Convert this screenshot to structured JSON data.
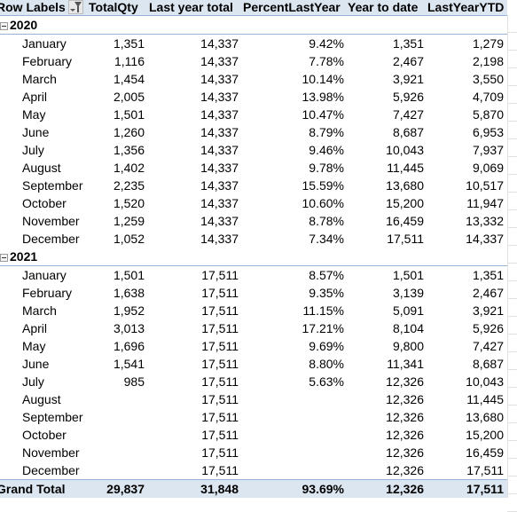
{
  "pivot": {
    "headers": {
      "row_labels": "Row Labels",
      "total_qty": "TotalQty",
      "last_year_total": "Last year total",
      "percent_last_year": "PercentLastYear",
      "year_to_date": "Year to date",
      "last_year_ytd": "LastYearYTD"
    },
    "filter_icon": "filter-dropdown-icon",
    "years": [
      {
        "label": "2020",
        "months": [
          {
            "month": "January",
            "total_qty": "1,351",
            "last_year_total": "14,337",
            "percent_last_year": "9.42%",
            "year_to_date": "1,351",
            "last_year_ytd": "1,279"
          },
          {
            "month": "February",
            "total_qty": "1,116",
            "last_year_total": "14,337",
            "percent_last_year": "7.78%",
            "year_to_date": "2,467",
            "last_year_ytd": "2,198"
          },
          {
            "month": "March",
            "total_qty": "1,454",
            "last_year_total": "14,337",
            "percent_last_year": "10.14%",
            "year_to_date": "3,921",
            "last_year_ytd": "3,550"
          },
          {
            "month": "April",
            "total_qty": "2,005",
            "last_year_total": "14,337",
            "percent_last_year": "13.98%",
            "year_to_date": "5,926",
            "last_year_ytd": "4,709"
          },
          {
            "month": "May",
            "total_qty": "1,501",
            "last_year_total": "14,337",
            "percent_last_year": "10.47%",
            "year_to_date": "7,427",
            "last_year_ytd": "5,870"
          },
          {
            "month": "June",
            "total_qty": "1,260",
            "last_year_total": "14,337",
            "percent_last_year": "8.79%",
            "year_to_date": "8,687",
            "last_year_ytd": "6,953"
          },
          {
            "month": "July",
            "total_qty": "1,356",
            "last_year_total": "14,337",
            "percent_last_year": "9.46%",
            "year_to_date": "10,043",
            "last_year_ytd": "7,937"
          },
          {
            "month": "August",
            "total_qty": "1,402",
            "last_year_total": "14,337",
            "percent_last_year": "9.78%",
            "year_to_date": "11,445",
            "last_year_ytd": "9,069"
          },
          {
            "month": "September",
            "total_qty": "2,235",
            "last_year_total": "14,337",
            "percent_last_year": "15.59%",
            "year_to_date": "13,680",
            "last_year_ytd": "10,517"
          },
          {
            "month": "October",
            "total_qty": "1,520",
            "last_year_total": "14,337",
            "percent_last_year": "10.60%",
            "year_to_date": "15,200",
            "last_year_ytd": "11,947"
          },
          {
            "month": "November",
            "total_qty": "1,259",
            "last_year_total": "14,337",
            "percent_last_year": "8.78%",
            "year_to_date": "16,459",
            "last_year_ytd": "13,332"
          },
          {
            "month": "December",
            "total_qty": "1,052",
            "last_year_total": "14,337",
            "percent_last_year": "7.34%",
            "year_to_date": "17,511",
            "last_year_ytd": "14,337"
          }
        ]
      },
      {
        "label": "2021",
        "months": [
          {
            "month": "January",
            "total_qty": "1,501",
            "last_year_total": "17,511",
            "percent_last_year": "8.57%",
            "year_to_date": "1,501",
            "last_year_ytd": "1,351"
          },
          {
            "month": "February",
            "total_qty": "1,638",
            "last_year_total": "17,511",
            "percent_last_year": "9.35%",
            "year_to_date": "3,139",
            "last_year_ytd": "2,467"
          },
          {
            "month": "March",
            "total_qty": "1,952",
            "last_year_total": "17,511",
            "percent_last_year": "11.15%",
            "year_to_date": "5,091",
            "last_year_ytd": "3,921"
          },
          {
            "month": "April",
            "total_qty": "3,013",
            "last_year_total": "17,511",
            "percent_last_year": "17.21%",
            "year_to_date": "8,104",
            "last_year_ytd": "5,926"
          },
          {
            "month": "May",
            "total_qty": "1,696",
            "last_year_total": "17,511",
            "percent_last_year": "9.69%",
            "year_to_date": "9,800",
            "last_year_ytd": "7,427"
          },
          {
            "month": "June",
            "total_qty": "1,541",
            "last_year_total": "17,511",
            "percent_last_year": "8.80%",
            "year_to_date": "11,341",
            "last_year_ytd": "8,687"
          },
          {
            "month": "July",
            "total_qty": "985",
            "last_year_total": "17,511",
            "percent_last_year": "5.63%",
            "year_to_date": "12,326",
            "last_year_ytd": "10,043"
          },
          {
            "month": "August",
            "total_qty": "",
            "last_year_total": "17,511",
            "percent_last_year": "",
            "year_to_date": "12,326",
            "last_year_ytd": "11,445"
          },
          {
            "month": "September",
            "total_qty": "",
            "last_year_total": "17,511",
            "percent_last_year": "",
            "year_to_date": "12,326",
            "last_year_ytd": "13,680"
          },
          {
            "month": "October",
            "total_qty": "",
            "last_year_total": "17,511",
            "percent_last_year": "",
            "year_to_date": "12,326",
            "last_year_ytd": "15,200"
          },
          {
            "month": "November",
            "total_qty": "",
            "last_year_total": "17,511",
            "percent_last_year": "",
            "year_to_date": "12,326",
            "last_year_ytd": "16,459"
          },
          {
            "month": "December",
            "total_qty": "",
            "last_year_total": "17,511",
            "percent_last_year": "",
            "year_to_date": "12,326",
            "last_year_ytd": "17,511"
          }
        ]
      }
    ],
    "grand_total": {
      "label": "Grand Total",
      "total_qty": "29,837",
      "last_year_total": "31,848",
      "percent_last_year": "93.69%",
      "year_to_date": "12,326",
      "last_year_ytd": "17,511"
    }
  }
}
